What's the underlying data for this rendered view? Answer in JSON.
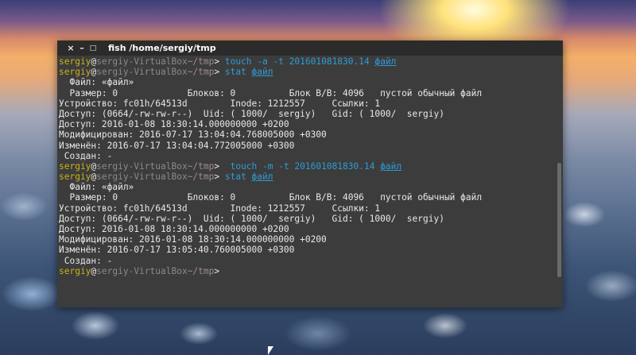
{
  "window": {
    "title": "fish  /home/sergiy/tmp",
    "buttons": {
      "close": "×",
      "minimize": "–",
      "maximize": "□"
    }
  },
  "prompt": {
    "user": "sergiy",
    "at": "@",
    "host": "sergiy-VirtualBox",
    "path": "~/tmp",
    "symbol": "> "
  },
  "lines": [
    {
      "kind": "prompt",
      "cmd": "touch -a -t 201601081830.14 ",
      "arg": "файл"
    },
    {
      "kind": "prompt",
      "cmd": "stat ",
      "arg": "файл"
    },
    {
      "kind": "out",
      "text": "  Файл: «файл»"
    },
    {
      "kind": "out",
      "text": "  Размер: 0             Блоков: 0          Блок В/В: 4096   пустой обычный файл"
    },
    {
      "kind": "out",
      "text": "Устройство: fc01h/64513d        Inode: 1212557     Ссылки: 1"
    },
    {
      "kind": "out",
      "text": "Доступ: (0664/-rw-rw-r--)  Uid: ( 1000/  sergiy)   Gid: ( 1000/  sergiy)"
    },
    {
      "kind": "out",
      "text": "Доступ: 2016-01-08 18:30:14.000000000 +0200"
    },
    {
      "kind": "out",
      "text": "Модифицирован: 2016-07-17 13:04:04.768005000 +0300"
    },
    {
      "kind": "out",
      "text": "Изменён: 2016-07-17 13:04:04.772005000 +0300"
    },
    {
      "kind": "out",
      "text": " Создан: -"
    },
    {
      "kind": "prompt",
      "cmd": " touch -m -t 201601081830.14 ",
      "arg": "файл"
    },
    {
      "kind": "prompt",
      "cmd": "stat ",
      "arg": "файл"
    },
    {
      "kind": "out",
      "text": "  Файл: «файл»"
    },
    {
      "kind": "out",
      "text": "  Размер: 0             Блоков: 0          Блок В/В: 4096   пустой обычный файл"
    },
    {
      "kind": "out",
      "text": "Устройство: fc01h/64513d        Inode: 1212557     Ссылки: 1"
    },
    {
      "kind": "out",
      "text": "Доступ: (0664/-rw-rw-r--)  Uid: ( 1000/  sergiy)   Gid: ( 1000/  sergiy)"
    },
    {
      "kind": "out",
      "text": "Доступ: 2016-01-08 18:30:14.000000000 +0200"
    },
    {
      "kind": "out",
      "text": "Модифицирован: 2016-01-08 18:30:14.000000000 +0200"
    },
    {
      "kind": "out",
      "text": "Изменён: 2016-07-17 13:05:40.760005000 +0300"
    },
    {
      "kind": "out",
      "text": " Создан: -"
    },
    {
      "kind": "prompt",
      "cmd": "",
      "arg": ""
    }
  ],
  "colors": {
    "user": "#c9b21a",
    "host": "#8a8a8a",
    "command": "#2e9bd6",
    "output": "#e8e8e8",
    "background": "#3c3c3c"
  }
}
